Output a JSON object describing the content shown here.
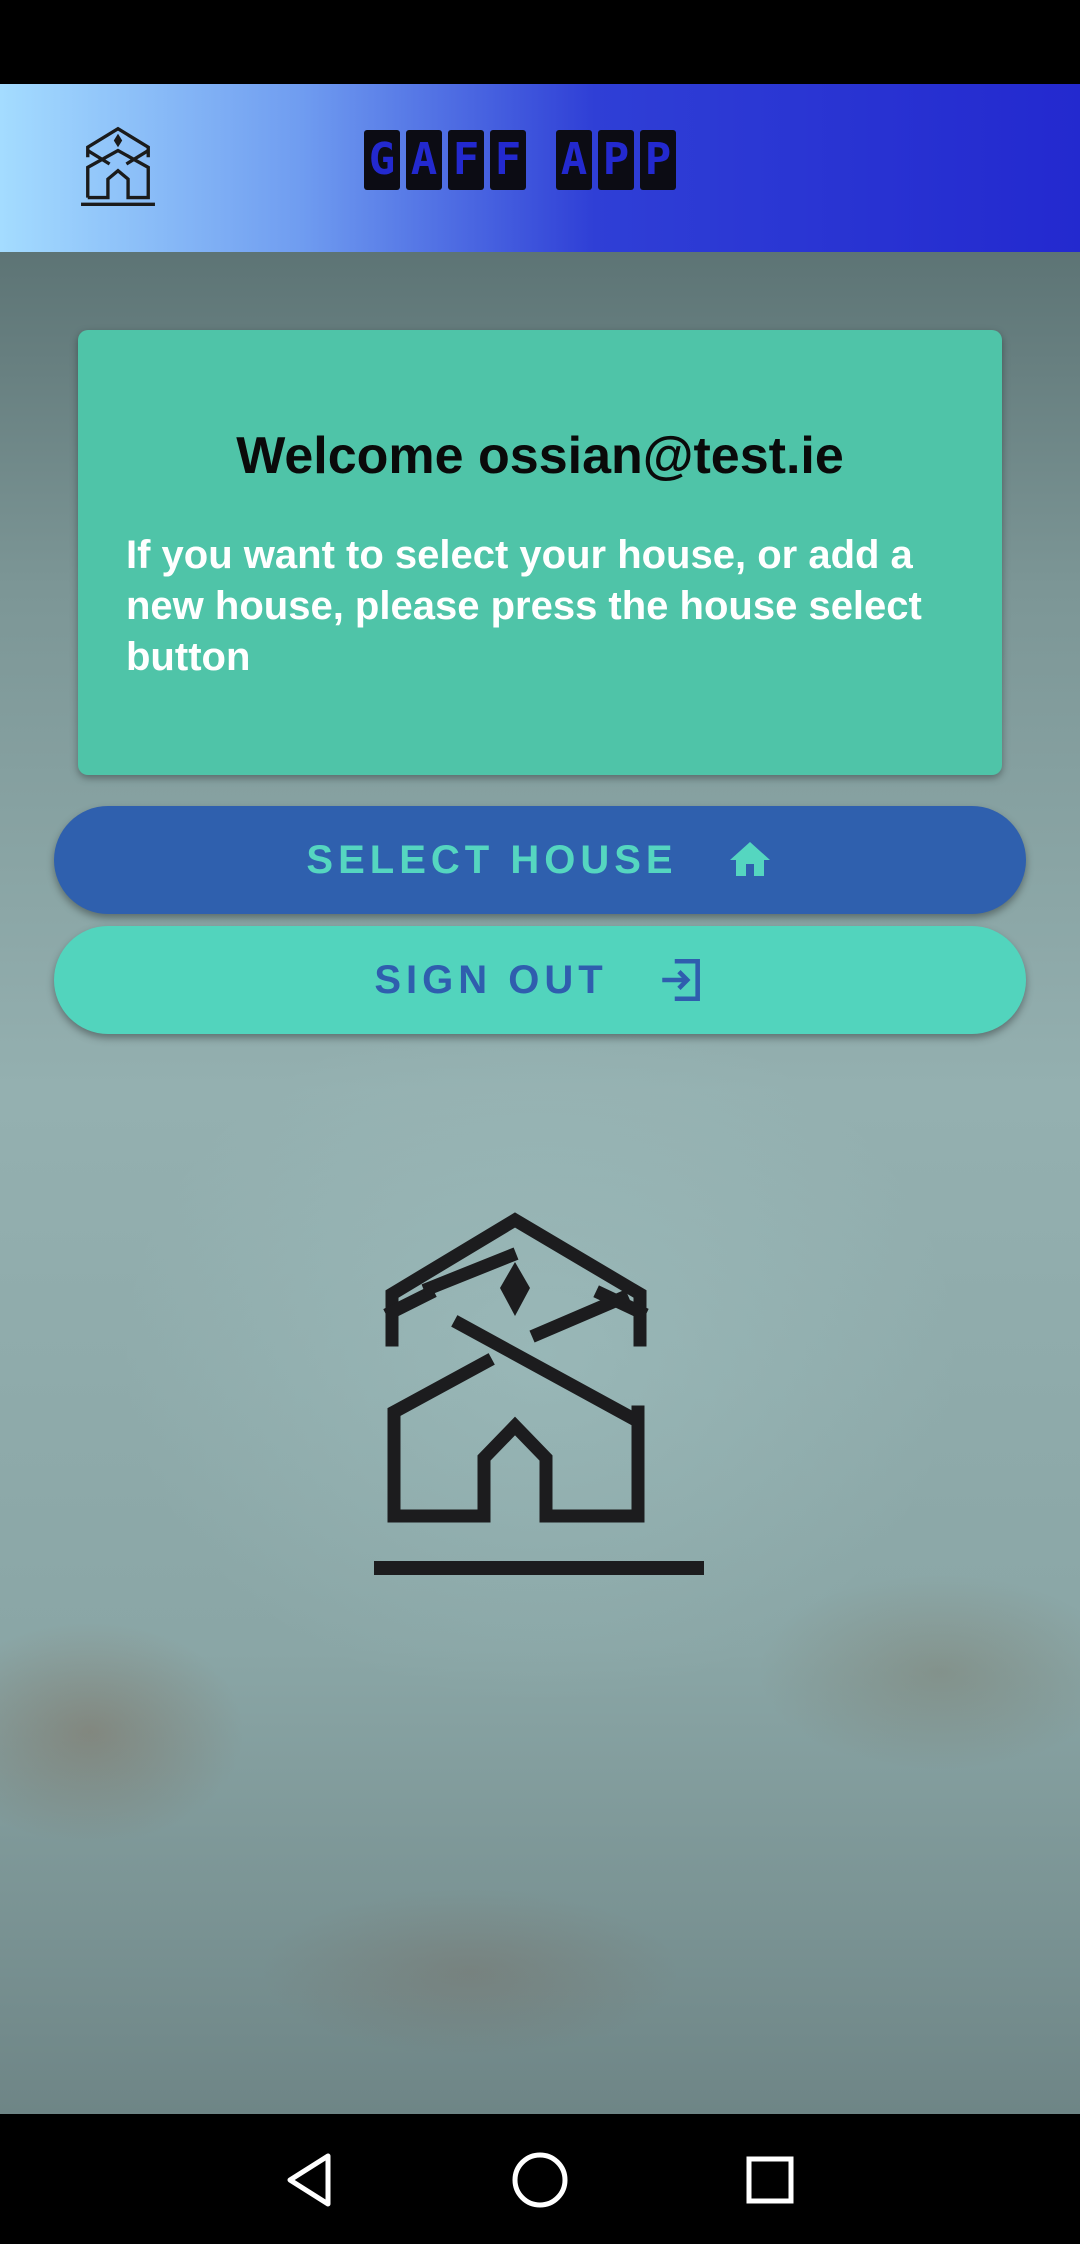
{
  "app": {
    "title_letters": [
      "G",
      "A",
      "F",
      "F",
      " ",
      "A",
      "P",
      "P"
    ]
  },
  "welcome": {
    "title": "Welcome ossian@test.ie",
    "message": "If you want to select your house, or add a new house, please press the house select button"
  },
  "buttons": {
    "select_house_label": "SELECT HOUSE",
    "sign_out_label": "SIGN OUT"
  },
  "icons": {
    "app_logo": "house-logo-icon",
    "select_house": "home-icon",
    "sign_out": "sign-out-icon",
    "nav_back": "back-triangle-icon",
    "nav_home": "home-circle-icon",
    "nav_recents": "recents-square-icon"
  },
  "colors": {
    "app_bar_start": "#a4dcff",
    "app_bar_end": "#2329cf",
    "card": "#4fc4a8",
    "select_button": "#2f60ae",
    "sign_out_button": "#52d4bd"
  }
}
